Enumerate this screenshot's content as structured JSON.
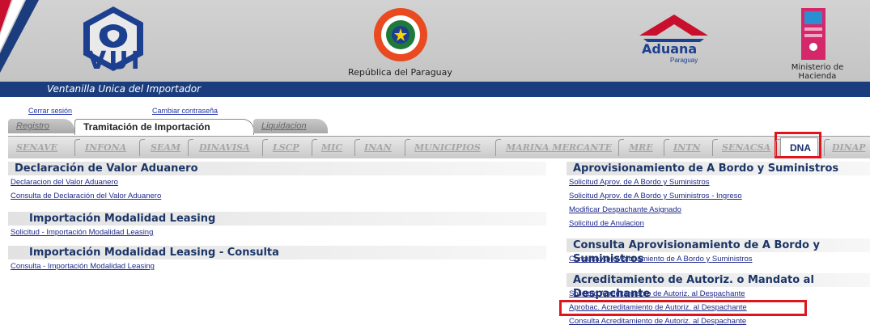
{
  "header": {
    "logo_text": "VUI",
    "subtitle": "Ventanilla Unica del Importador",
    "republica": "República del Paraguay",
    "aduana": "Aduana",
    "aduana_sub": "Paraguay",
    "ministerio_line1": "Ministerio de",
    "ministerio_line2": "Hacienda"
  },
  "session": {
    "logout": "Cerrar sesión",
    "change_password": "Cambiar contraseña"
  },
  "tabs": {
    "registro": "Registro",
    "tramitacion": "Tramitación de Importación",
    "liquidacion": "Liquidacion"
  },
  "subtabs": [
    "SENAVE",
    "INFONA",
    "SEAM",
    "DINAVISA",
    "LSCP",
    "MIC",
    "INAN",
    "MUNICIPIOS",
    "MARINA MERCANTE",
    "MRE",
    "INTN",
    "SENACSA",
    "DNA",
    "DINAP"
  ],
  "left": {
    "s1": {
      "title": "Declaración de Valor Aduanero",
      "links": [
        "Declaracion del Valor Aduanero",
        "Consulta de Declaración del Valor Aduanero"
      ]
    },
    "s2": {
      "title": "Importación Modalidad Leasing",
      "links": [
        "Solicitud - Importación Modalidad Leasing"
      ]
    },
    "s3": {
      "title": "Importación Modalidad Leasing - Consulta",
      "links": [
        "Consulta - Importación Modalidad Leasing"
      ]
    }
  },
  "right": {
    "s1": {
      "title": "Aprovisionamiento de A Bordo y Suministros",
      "links": [
        "Solicitud Aprov. de A Bordo y Suministros",
        "Solicitud Aprov. de A Bordo y Suministros - Ingreso",
        "Modificar Despachante Asignado",
        "Solicitud de Anulacion"
      ]
    },
    "s2": {
      "title": "Consulta Aprovisionamiento de A Bordo y Suministros",
      "links": [
        "Consulta Aprovisionamiento de A Bordo y Suministros"
      ]
    },
    "s3": {
      "title": "Acreditamiento de Autoriz. o Mandato al Despachante",
      "links": [
        "Solicitud Acreditamiento de Autoriz. al Despachante",
        "Aprobac. Acreditamiento de Autoriz. al Despachante",
        "Consulta Acreditamiento de Autoriz. al Despachante"
      ]
    }
  },
  "colors": {
    "accent": "#1b3d7d",
    "highlight": "#e0141c"
  }
}
